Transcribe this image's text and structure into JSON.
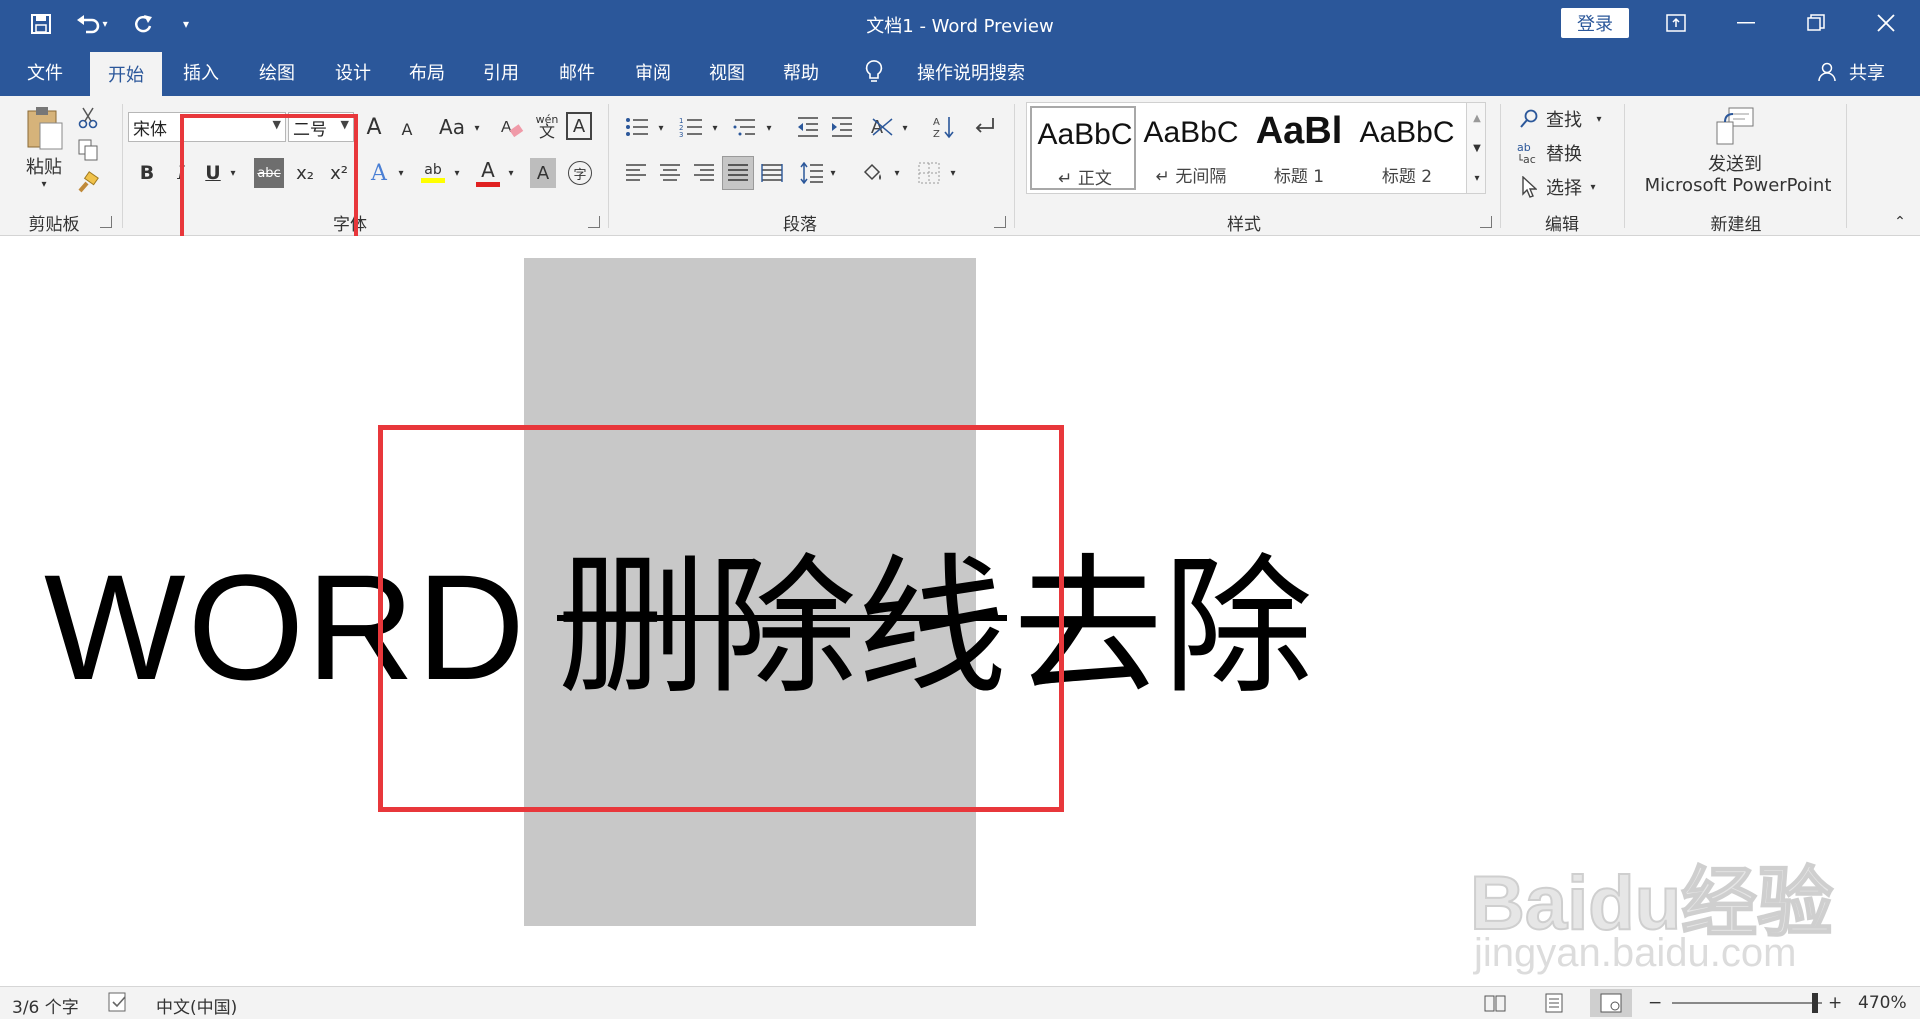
{
  "titlebar": {
    "title": "文档1  -  Word Preview",
    "login_label": "登录",
    "save_icon": "save-icon",
    "undo_icon": "undo-icon",
    "redo_icon": "redo-icon"
  },
  "tabs": [
    "文件",
    "开始",
    "插入",
    "绘图",
    "设计",
    "布局",
    "引用",
    "邮件",
    "审阅",
    "视图",
    "帮助",
    "操作说明搜索"
  ],
  "share_label": "共享",
  "ribbon": {
    "clipboard": {
      "paste": "粘贴",
      "label": "剪贴板"
    },
    "font": {
      "name": "宋体",
      "size": "二号",
      "label": "字体",
      "bold": "B",
      "italic": "I",
      "underline": "U",
      "strike": "abc",
      "sub": "x₂",
      "sup": "x²",
      "grow": "A",
      "shrink": "A",
      "case": "Aa",
      "phonetic": "wén",
      "border_char": "A",
      "effects": "A",
      "highlight": "ab",
      "color": "A",
      "shade": "A",
      "encircle": "字"
    },
    "paragraph": {
      "label": "段落"
    },
    "styles": {
      "label": "样式",
      "items": [
        {
          "sample": "AaBbC",
          "name": "↵ 正文"
        },
        {
          "sample": "AaBbC",
          "name": "↵ 无间隔"
        },
        {
          "sample": "AaBl",
          "name": "标题 1"
        },
        {
          "sample": "AaBbC",
          "name": "标题 2"
        }
      ]
    },
    "editing": {
      "label": "编辑",
      "find": "查找",
      "replace": "替换",
      "select": "选择"
    },
    "newgroup": {
      "label": "新建组",
      "send_line1": "发送到",
      "send_line2": "Microsoft PowerPoint"
    }
  },
  "document": {
    "text_plain": "WORD",
    "text_struck": "删除线",
    "text_rest": "去除"
  },
  "watermark": {
    "logo": "Baidu经验",
    "url": "jingyan.baidu.com"
  },
  "status": {
    "word_count": "3/6 个字",
    "language": "中文(中国)",
    "zoom": "470%"
  }
}
